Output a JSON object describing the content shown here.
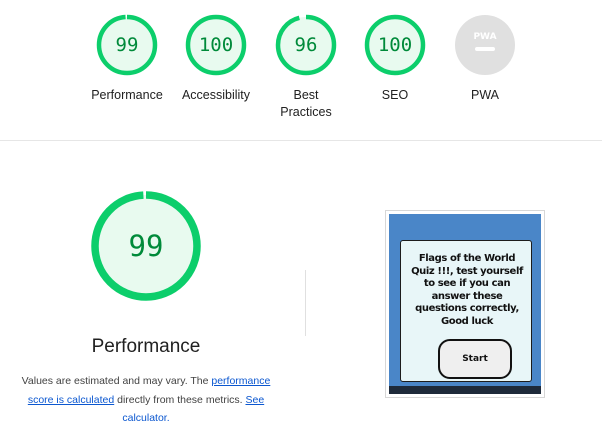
{
  "scores": [
    {
      "value": "99",
      "label": "Performance",
      "fraction": 0.99
    },
    {
      "value": "100",
      "label": "Accessibility",
      "fraction": 1.0
    },
    {
      "value": "96",
      "label": "Best\nPractices",
      "fraction": 0.96
    },
    {
      "value": "100",
      "label": "SEO",
      "fraction": 1.0
    }
  ],
  "pwa": {
    "label": "PWA",
    "icon_text": "PWA"
  },
  "performance_detail": {
    "score": "99",
    "fraction": 0.99,
    "title": "Performance",
    "note_prefix": "Values are estimated and may vary. The ",
    "note_link1": "performance score is calculated",
    "note_middle": " directly from these metrics. ",
    "note_link2": "See calculator."
  },
  "screenshot": {
    "card_text": "Flags of the World Quiz !!!, test yourself to see if you can answer these questions correctly, Good luck",
    "button_label": "Start"
  },
  "colors": {
    "pass_stroke": "#0cce6b",
    "pass_fill": "#e8faef",
    "pass_text": "#008a3a",
    "pwa_gray": "#e0e0e0"
  }
}
